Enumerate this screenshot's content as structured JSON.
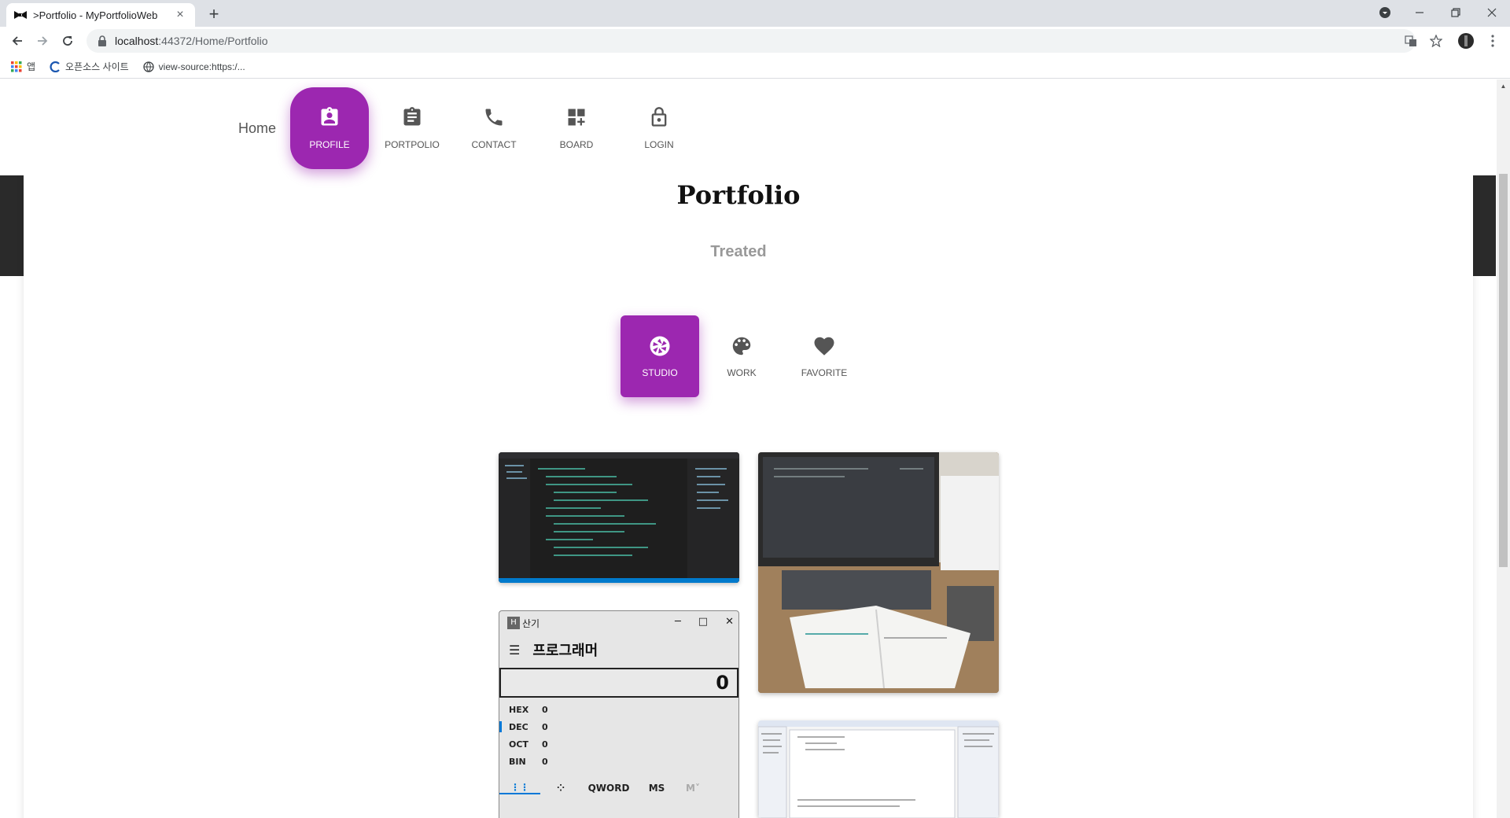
{
  "browser": {
    "tab_title": ">Portfolio - MyPortfolioWeb",
    "tab_close": "×",
    "new_tab": "+",
    "url_host": "localhost",
    "url_path": ":44372/Home/Portfolio",
    "bookmarks": [
      {
        "label": "앱",
        "icon": "apps-grid-icon"
      },
      {
        "label": "오픈소스 사이트",
        "icon": "site-logo-icon"
      },
      {
        "label": "view-source:https:/...",
        "icon": "globe-icon"
      }
    ]
  },
  "nav": {
    "brand": "Home",
    "items": [
      {
        "label": "PROFILE",
        "icon": "badge-icon",
        "active": true
      },
      {
        "label": "PORTPOLIO",
        "icon": "clipboard-icon",
        "active": false
      },
      {
        "label": "CONTACT",
        "icon": "phone-icon",
        "active": false
      },
      {
        "label": "BOARD",
        "icon": "dashboard-add-icon",
        "active": false
      },
      {
        "label": "LOGIN",
        "icon": "lock-open-icon",
        "active": false
      }
    ]
  },
  "page": {
    "title": "Portfolio",
    "subtitle": "Treated"
  },
  "filters": [
    {
      "label": "STUDIO",
      "icon": "camera-aperture-icon",
      "active": true
    },
    {
      "label": "WORK",
      "icon": "palette-icon",
      "active": false
    },
    {
      "label": "FAVORITE",
      "icon": "heart-icon",
      "active": false
    }
  ],
  "calculator": {
    "app_icon": "H",
    "window_title": "산기",
    "mode": "프로그래머",
    "display": "0",
    "rows": [
      {
        "key": "HEX",
        "value": "0"
      },
      {
        "key": "DEC",
        "value": "0"
      },
      {
        "key": "OCT",
        "value": "0"
      },
      {
        "key": "BIN",
        "value": "0"
      }
    ],
    "word_size": "QWORD",
    "ms": "MS",
    "mr": "M˅"
  },
  "colors": {
    "accent": "#9c27b0",
    "text_muted": "#999999"
  }
}
